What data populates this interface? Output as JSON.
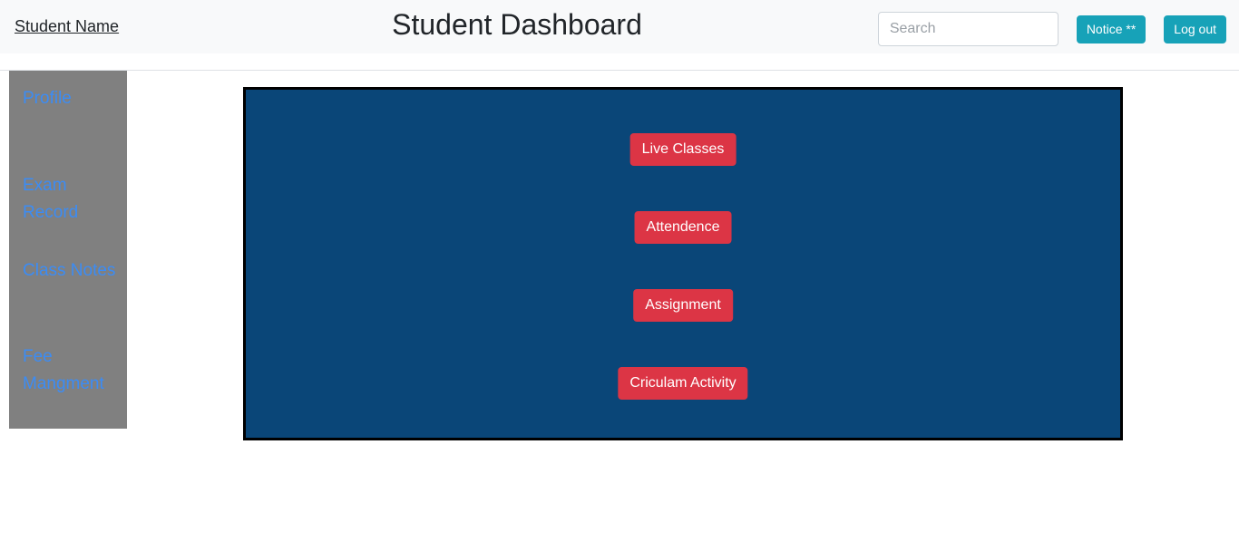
{
  "header": {
    "brand": "Student Name",
    "title": "Student Dashboard",
    "search": {
      "placeholder": "Search",
      "value": ""
    },
    "notice_button": "Notice **",
    "logout_button": "Log out",
    "background_color": "#f8f9fa",
    "button_color": "#17a2b8"
  },
  "sidebar": {
    "background_color": "#808080",
    "link_color": "#3b8cf5",
    "items": [
      {
        "label": "Profile"
      },
      {
        "label": "Exam Record"
      },
      {
        "label": "Class Notes"
      },
      {
        "label": "Fee Mangment"
      }
    ]
  },
  "main": {
    "panel_background_color": "#0a4678",
    "panel_border_color": "#000000",
    "button_color": "#dc3545",
    "actions": [
      {
        "label": "Live Classes"
      },
      {
        "label": "Attendence"
      },
      {
        "label": "Assignment"
      },
      {
        "label": "Criculam Activity"
      }
    ]
  }
}
